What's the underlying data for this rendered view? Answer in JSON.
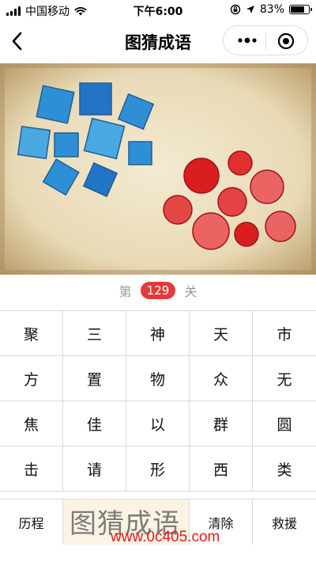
{
  "status_bar": {
    "carrier": "中国移动",
    "time": "下午6:00",
    "battery_text": "83%",
    "battery_level": 0.83,
    "icons": [
      "signal-icon",
      "wifi-icon",
      "rotation-lock-icon",
      "location-icon",
      "battery-icon"
    ]
  },
  "nav": {
    "title": "图猜成语",
    "back_icon": "chevron-left-icon",
    "more_icon": "more-dots-icon",
    "close_icon": "target-circle-icon"
  },
  "level": {
    "prefix": "第",
    "number": "129",
    "suffix": "关"
  },
  "characters": [
    "聚",
    "三",
    "神",
    "天",
    "市",
    "方",
    "置",
    "物",
    "众",
    "无",
    "焦",
    "佳",
    "以",
    "群",
    "圆",
    "击",
    "请",
    "形",
    "西",
    "类"
  ],
  "actions": {
    "history_label": "历程",
    "answer_value": "",
    "clear_label": "清除",
    "help_label": "救援"
  },
  "watermark": {
    "title": "图猜成语",
    "url": "www.0c405.com"
  },
  "colors": {
    "accent_red": "#e33b3b",
    "square_blue": "#3a95d6",
    "circle_red": "#e02a2a",
    "parchment": "#efe3c6"
  }
}
